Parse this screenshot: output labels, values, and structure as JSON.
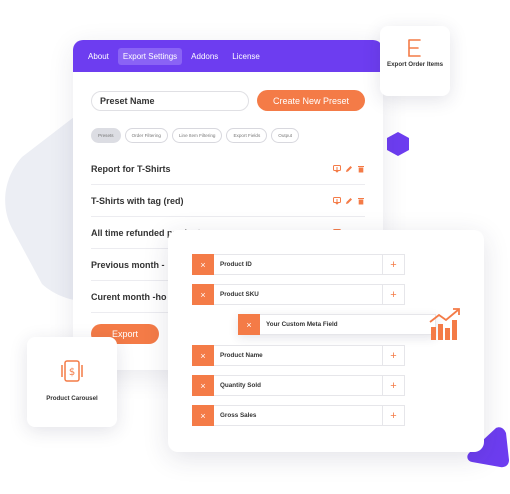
{
  "colors": {
    "accent": "#f47b47",
    "nav": "#6d3df0",
    "blob": "#eceef4",
    "text": "#333333"
  },
  "nav": {
    "tabs": [
      {
        "label": "About",
        "active": false
      },
      {
        "label": "Export Settings",
        "active": true
      },
      {
        "label": "Addons",
        "active": false
      },
      {
        "label": "License",
        "active": false
      }
    ]
  },
  "preset": {
    "input_value": "Preset Name",
    "create_label": "Create New Preset"
  },
  "filters": [
    {
      "label": "Presets",
      "active": true
    },
    {
      "label": "Order Filtering",
      "active": false
    },
    {
      "label": "Line Item Filtering",
      "active": false
    },
    {
      "label": "Export Fields",
      "active": false
    },
    {
      "label": "Output",
      "active": false
    }
  ],
  "presets": [
    {
      "name": "Report for T-Shirts",
      "icons": [
        "download-icon",
        "edit-icon",
        "trash-icon"
      ]
    },
    {
      "name": "T-Shirts with tag (red)",
      "icons": [
        "download-icon",
        "edit-icon",
        "trash-icon"
      ]
    },
    {
      "name": "All time refunded products",
      "icons": [
        "download-icon",
        "edit-icon",
        "trash-icon"
      ]
    },
    {
      "name": "Previous month - ",
      "icons": []
    },
    {
      "name": "Curent month -ho",
      "icons": []
    }
  ],
  "export_label": "Export",
  "order_card": {
    "label": "Export Order Items",
    "icon": "export-document-icon"
  },
  "carousel_card": {
    "label": "Product Carousel",
    "icon": "carousel-icon"
  },
  "fields": [
    {
      "label": "Product ID",
      "remove": "×",
      "add": "+"
    },
    {
      "label": "Product SKU",
      "remove": "×",
      "add": "+"
    },
    {
      "label": "Your Custom Meta Field",
      "remove": "×",
      "add": ""
    },
    {
      "label": "Product Name",
      "remove": "×",
      "add": "+"
    },
    {
      "label": "Quantity Sold",
      "remove": "×",
      "add": "+"
    },
    {
      "label": "Gross Sales",
      "remove": "×",
      "add": "+"
    }
  ],
  "decor": {
    "chart": "growth-chart-icon"
  }
}
